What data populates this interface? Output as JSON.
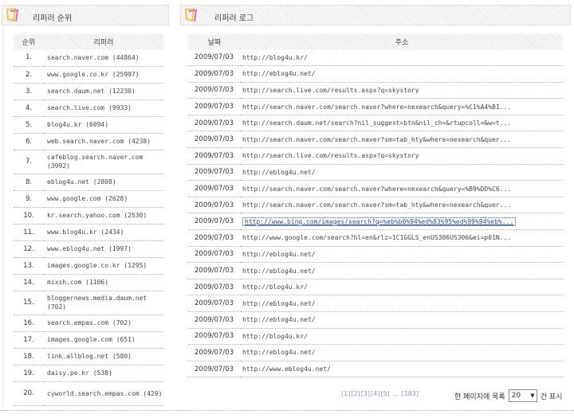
{
  "left_panel": {
    "title": "리퍼러 순위"
  },
  "right_panel": {
    "title": "리퍼러 로그"
  },
  "rank_table": {
    "headers": [
      "순위",
      "리퍼러"
    ],
    "rows": [
      {
        "n": "1.",
        "ref": "search.naver.com (44864)"
      },
      {
        "n": "2.",
        "ref": "www.google.co.kr (25997)"
      },
      {
        "n": "3.",
        "ref": "search.daum.net (12230)"
      },
      {
        "n": "4.",
        "ref": "search.live.com (9933)"
      },
      {
        "n": "5.",
        "ref": "blog4u.kr (6094)"
      },
      {
        "n": "6.",
        "ref": "web.search.naver.com (4238)"
      },
      {
        "n": "7.",
        "ref": "cafeblog.search.naver.com (3992)"
      },
      {
        "n": "8.",
        "ref": "eblog4u.net (2808)"
      },
      {
        "n": "9.",
        "ref": "www.google.com (2628)"
      },
      {
        "n": "10.",
        "ref": "kr.search.yahoo.com (2530)"
      },
      {
        "n": "11.",
        "ref": "www.blog4u.kr (2434)"
      },
      {
        "n": "12.",
        "ref": "www.eblog4u.net (1997)"
      },
      {
        "n": "13.",
        "ref": "images.google.co.kr (1295)"
      },
      {
        "n": "14.",
        "ref": "mixsh.com (1106)"
      },
      {
        "n": "15.",
        "ref": "bloggernews.media.daum.net (702)"
      },
      {
        "n": "16.",
        "ref": "search.empas.com (702)"
      },
      {
        "n": "17.",
        "ref": "images.google.com (651)"
      },
      {
        "n": "18.",
        "ref": "link.allblog.net (580)"
      },
      {
        "n": "19.",
        "ref": "daisy.pe.kr (538)"
      },
      {
        "n": "20.",
        "ref": "cyworld.search.empas.com (429)"
      }
    ]
  },
  "log_table": {
    "headers": [
      "날짜",
      "주소"
    ],
    "rows": [
      {
        "date": "2009/07/03",
        "url": "http://blog4u.kr/"
      },
      {
        "date": "2009/07/03",
        "url": "http://eblog4u.net/"
      },
      {
        "date": "2009/07/03",
        "url": "http://search.live.com/results.aspx?q=skystory"
      },
      {
        "date": "2009/07/03",
        "url": "http://search.naver.com/search.naver?where=nexearch&query=%C1%A4%B1..."
      },
      {
        "date": "2009/07/03",
        "url": "http://search.daum.net/search?nil_suggest=btn&nil_ch=&rtupcoll=&w=t..."
      },
      {
        "date": "2009/07/03",
        "url": "http://search.naver.com/search.naver?sm=tab_hty&where=nexearch&quer..."
      },
      {
        "date": "2009/07/03",
        "url": "http://search.live.com/results.aspx?q=skystory"
      },
      {
        "date": "2009/07/03",
        "url": "http://eblog4u.net/"
      },
      {
        "date": "2009/07/03",
        "url": "http://search.naver.com/search.naver?where=nexearch&query=%B9%DD%C6..."
      },
      {
        "date": "2009/07/03",
        "url": "http://search.naver.com/search.naver?sm=tab_hty&where=nexearch&quer..."
      },
      {
        "date": "2009/07/03",
        "url": "http://www.bing.com/images/search?q=%eb%b0%94%ed%83%95%ed%99%94%eb%..."
      },
      {
        "date": "2009/07/03",
        "url": "http://www.google.com/search?hl=en&rlz=1C1GGLS_enUS306US306&ei=p01N..."
      },
      {
        "date": "2009/07/03",
        "url": "http://eblog4u.net/"
      },
      {
        "date": "2009/07/03",
        "url": "http://eblog4u.net/"
      },
      {
        "date": "2009/07/03",
        "url": "http://blog4u.kr/"
      },
      {
        "date": "2009/07/03",
        "url": "http://eblog4u.net/"
      },
      {
        "date": "2009/07/03",
        "url": "http://eblog4u.net/"
      },
      {
        "date": "2009/07/03",
        "url": "http://blog4u.kr/"
      },
      {
        "date": "2009/07/03",
        "url": "http://eblog4u.net/"
      },
      {
        "date": "2009/07/03",
        "url": "http://www.eblog4u.net/"
      }
    ]
  },
  "pager": {
    "pages": [
      "[1]",
      "[2]",
      "[3]",
      "[4]",
      "[5]",
      "...",
      "[183]"
    ]
  },
  "per_page": {
    "label_before": "한 페이지에 목록",
    "value": "20",
    "label_after": "건 표시"
  }
}
